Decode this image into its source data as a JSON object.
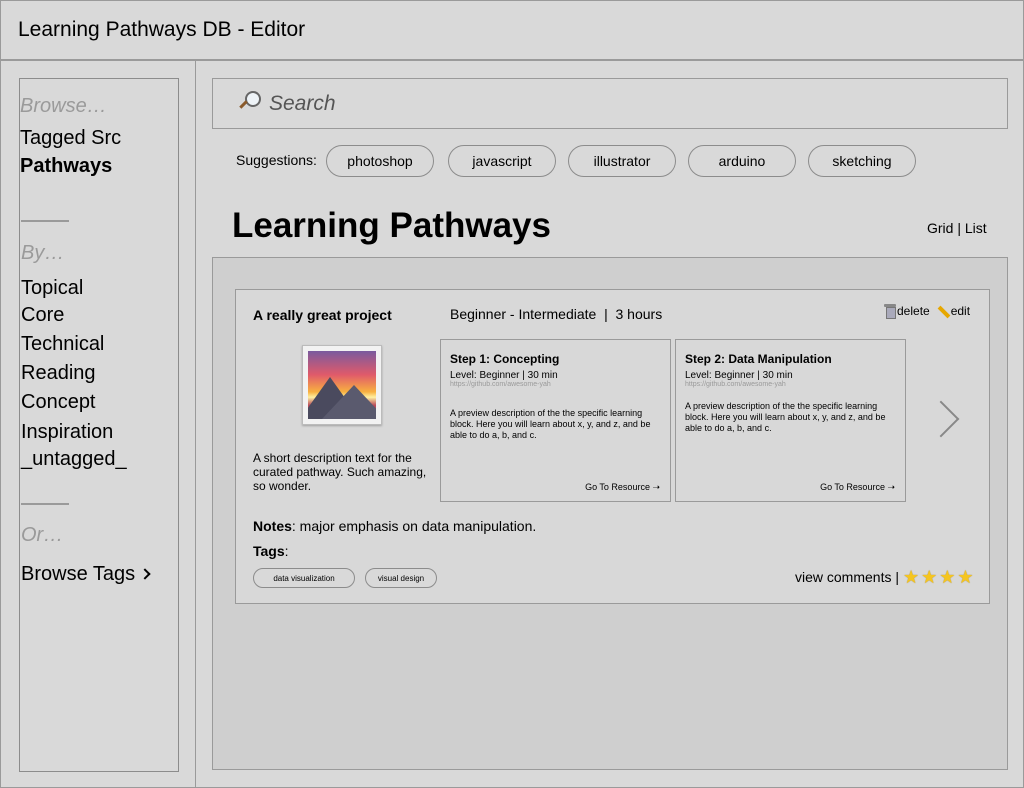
{
  "window": {
    "title": "Learning Pathways DB - Editor"
  },
  "sidebar": {
    "browse_hint": "Browse…",
    "browse_items": [
      "Tagged Src",
      "Pathways"
    ],
    "by_hint": "By…",
    "by_items": [
      "Topical",
      "Core",
      "Technical",
      "Reading",
      "Concept",
      "Inspiration",
      "_untagged_"
    ],
    "or_hint": "Or…",
    "browse_tags": "Browse Tags"
  },
  "search": {
    "placeholder": "Search",
    "icon": "magnifier-icon"
  },
  "suggestions": {
    "label": "Suggestions:",
    "items": [
      "photoshop",
      "javascript",
      "illustrator",
      "arduino",
      "sketching"
    ]
  },
  "page": {
    "title": "Learning Pathways",
    "view_grid": "Grid",
    "view_sep": "|",
    "view_list": "List"
  },
  "card": {
    "title": "A really great project",
    "meta": "Beginner - Intermediate  |  3 hours",
    "delete_label": "delete",
    "edit_label": "edit",
    "description": "A short description text for the curated pathway. Such amazing, so wonder.",
    "steps": [
      {
        "title": "Step 1: Concepting",
        "level": "Level: Beginner | 30 min",
        "url": "https://github.com/awesome-yah",
        "description": "A preview description of the the specific learning block. Here you will learn about x, y, and z, and be able to do a, b, and c.",
        "link": "Go To Resource ➝"
      },
      {
        "title": "Step 2: Data Manipulation",
        "level": "Level: Beginner | 30 min",
        "url": "https://github.com/awesome-yah",
        "description": "A preview description of the the specific learning block. Here you will learn about x, y, and z, and be able to do a, b, and c.",
        "link": "Go To Resource ➝"
      }
    ],
    "notes_label": "Notes",
    "notes_text": ": major emphasis on data manipulation.",
    "tags_label": "Tags",
    "tags_colon": ":",
    "tags": [
      "data visualization",
      "visual design"
    ],
    "comments_label": "view comments |",
    "rating": 4
  },
  "colors": {
    "background": "#d9d9d9",
    "border": "#9a9a9a",
    "star": "#f5c51f"
  }
}
